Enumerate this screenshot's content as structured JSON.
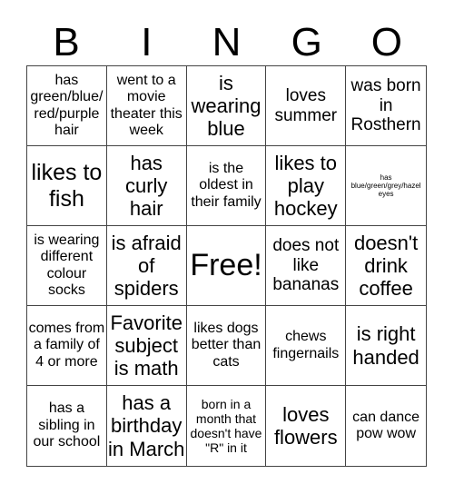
{
  "header": {
    "letters": [
      "B",
      "I",
      "N",
      "G",
      "O"
    ]
  },
  "cells": [
    "has green/blue/ red/purple hair",
    "went to a movie theater this week",
    "is wearing blue",
    "loves summer",
    "was born in Rosthern",
    "likes to fish",
    "has curly hair",
    "is the oldest in their family",
    "likes to play hockey",
    "has blue/green/grey/hazel eyes",
    "is wearing different colour socks",
    "is afraid of spiders",
    "Free!",
    "does not like bananas",
    "doesn't drink coffee",
    "comes from a family of 4 or more",
    "Favorite subject is math",
    "likes dogs better than cats",
    "chews fingernails",
    "is right handed",
    "has a sibling in our school",
    "has a birthday in March",
    "born in a month that doesn't have \"R\" in it",
    "loves flowers",
    "can dance pow wow"
  ]
}
